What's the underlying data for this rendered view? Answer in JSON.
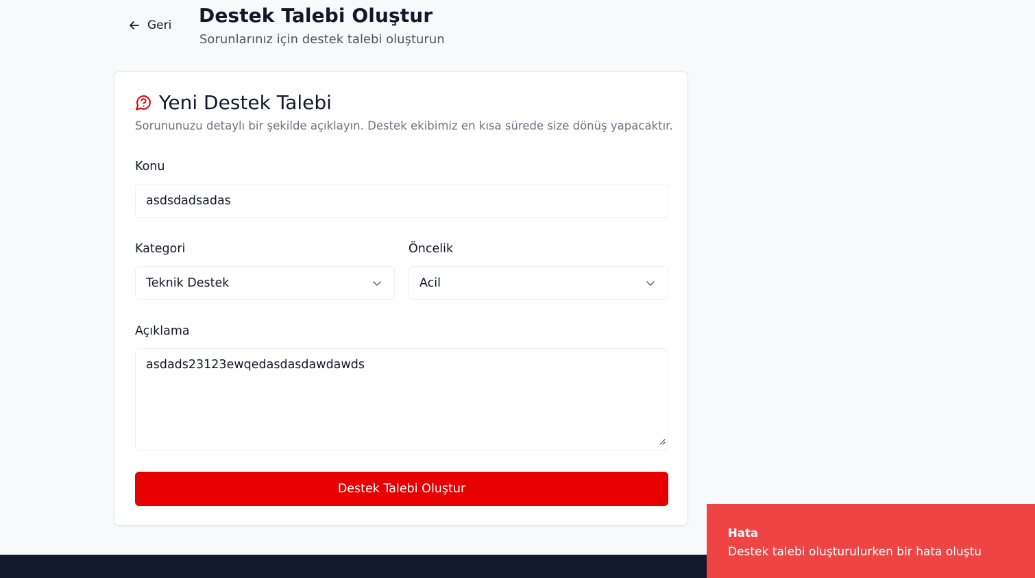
{
  "header": {
    "back_label": "Geri",
    "title": "Destek Talebi Oluştur",
    "subtitle": "Sorunlarınız için destek talebi oluşturun"
  },
  "card": {
    "title": "Yeni Destek Talebi",
    "description": "Sorununuzu detaylı bir şekilde açıklayın. Destek ekibimiz en kısa sürede size dönüş yapacaktır.",
    "icon": "message-question-icon"
  },
  "form": {
    "subject_label": "Konu",
    "subject_value": "asdsdadsadas",
    "category_label": "Kategori",
    "category_value": "Teknik Destek",
    "priority_label": "Öncelik",
    "priority_value": "Acil",
    "description_label": "Açıklama",
    "description_value": "asdads23123ewqedasdasdawdawds",
    "submit_label": "Destek Talebi Oluştur"
  },
  "toast": {
    "title": "Hata",
    "message": "Destek talebi oluşturulurken bir hata oluştu"
  },
  "colors": {
    "accent": "#e60000",
    "toast_bg": "#ef4444",
    "footer_bg": "#121a2a",
    "page_bg": "#f8f9fb"
  }
}
